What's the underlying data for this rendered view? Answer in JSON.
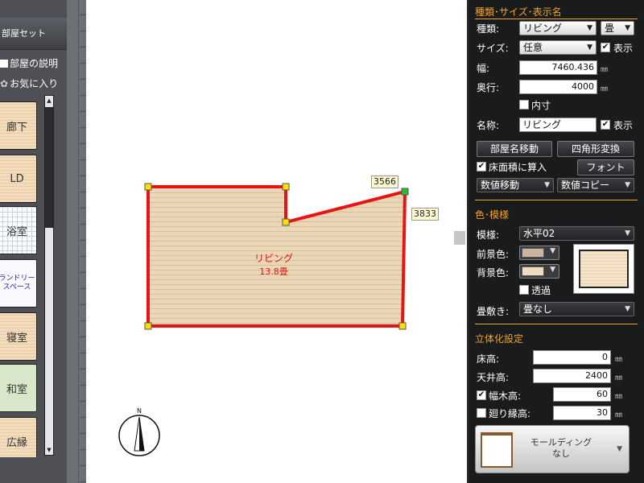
{
  "left_panel": {
    "title": "部屋セット",
    "room_description_label": "部屋の説明",
    "favorites_label": "お気に入り",
    "tiles": [
      "廊下",
      "LD",
      "浴室",
      "ランドリー\nスペース",
      "寝室",
      "和室",
      "広縁"
    ]
  },
  "canvas": {
    "room_name": "リビング",
    "room_area": "13.8畳",
    "dim_top": "3566",
    "dim_right": "3833",
    "compass_label": "N",
    "room_fill_color": "#ead7b8",
    "room_stroke_color": "#e81313"
  },
  "properties": {
    "section_type_title": "種類･サイズ･表示名",
    "type_label": "種類:",
    "type_value": "リビング",
    "unit_value": "畳",
    "size_label": "サイズ:",
    "size_value": "任意",
    "show_label": "表示",
    "width_label": "幅:",
    "width_value": "7460.436",
    "depth_label": "奥行:",
    "depth_value": "4000",
    "mm": "㎜",
    "inner_label": "内寸",
    "name_label": "名称:",
    "name_value": "リビング",
    "name_show_label": "表示",
    "move_name_button": "部屋名移動",
    "rect_convert_button": "四角形変換",
    "floor_area_label": "床面積に算入",
    "font_button": "フォント",
    "numeric_move": "数値移動",
    "numeric_copy": "数値コピー",
    "section_color_title": "色･模様",
    "pattern_label": "模様:",
    "pattern_value": "水平02",
    "fg_color_label": "前景色:",
    "bg_color_label": "背景色:",
    "fg_color": "#c9b5a0",
    "bg_color": "#efdcc0",
    "transparent_label": "透過",
    "tatami_label": "畳敷き:",
    "tatami_value": "畳なし",
    "section_3d_title": "立体化設定",
    "floor_height_label": "床高:",
    "floor_height_value": "0",
    "ceiling_height_label": "天井高:",
    "ceiling_height_value": "2400",
    "baseboard_label": "幅木高:",
    "baseboard_value": "60",
    "mawari_label": "廻り縁高:",
    "mawari_value": "30",
    "molding_line1": "モールディング",
    "molding_line2": "なし"
  }
}
